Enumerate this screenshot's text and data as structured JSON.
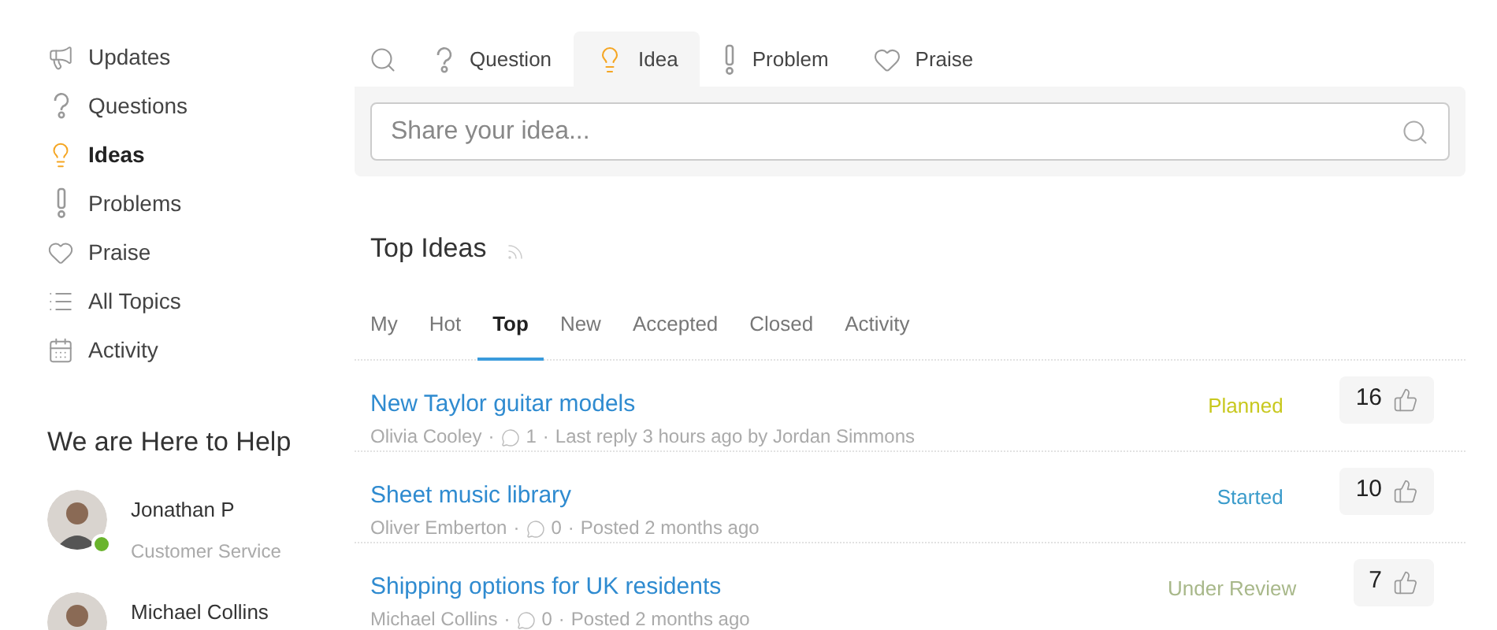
{
  "sidebar": {
    "items": [
      {
        "label": "Updates",
        "selected": false
      },
      {
        "label": "Questions",
        "selected": false
      },
      {
        "label": "Ideas",
        "selected": true
      },
      {
        "label": "Problems",
        "selected": false
      },
      {
        "label": "Praise",
        "selected": false
      },
      {
        "label": "All Topics",
        "selected": false
      },
      {
        "label": "Activity",
        "selected": false
      }
    ],
    "help": {
      "title": "We are Here to Help",
      "agents": [
        {
          "name": "Jonathan P",
          "role": "Customer Service",
          "online": true
        },
        {
          "name": "Michael Collins"
        }
      ]
    }
  },
  "post_types": [
    {
      "label": "Question",
      "selected": false
    },
    {
      "label": "Idea",
      "selected": true
    },
    {
      "label": "Problem",
      "selected": false
    },
    {
      "label": "Praise",
      "selected": false
    }
  ],
  "search": {
    "placeholder": "Share your idea..."
  },
  "section_title": "Top Ideas",
  "meta_separator": "·",
  "filters": [
    {
      "label": "My",
      "selected": false
    },
    {
      "label": "Hot",
      "selected": false
    },
    {
      "label": "Top",
      "selected": true
    },
    {
      "label": "New",
      "selected": false
    },
    {
      "label": "Accepted",
      "selected": false
    },
    {
      "label": "Closed",
      "selected": false
    },
    {
      "label": "Activity",
      "selected": false
    }
  ],
  "topics": [
    {
      "title": "New Taylor guitar models",
      "author": "Olivia Cooley",
      "comments": "1",
      "activity": "Last reply 3 hours ago by Jordan Simmons",
      "status": "Planned",
      "color": "#c8c81e",
      "votes": "16"
    },
    {
      "title": "Sheet music library",
      "author": "Oliver Emberton",
      "comments": "0",
      "activity": "Posted 2 months ago",
      "status": "Started",
      "color": "#3a9bcb",
      "votes": "10"
    },
    {
      "title": "Shipping options for UK residents",
      "author": "Michael Collins",
      "comments": "0",
      "activity": "Posted 2 months ago",
      "status": "Under Review",
      "color": "#a8b88a",
      "votes": "7"
    }
  ]
}
